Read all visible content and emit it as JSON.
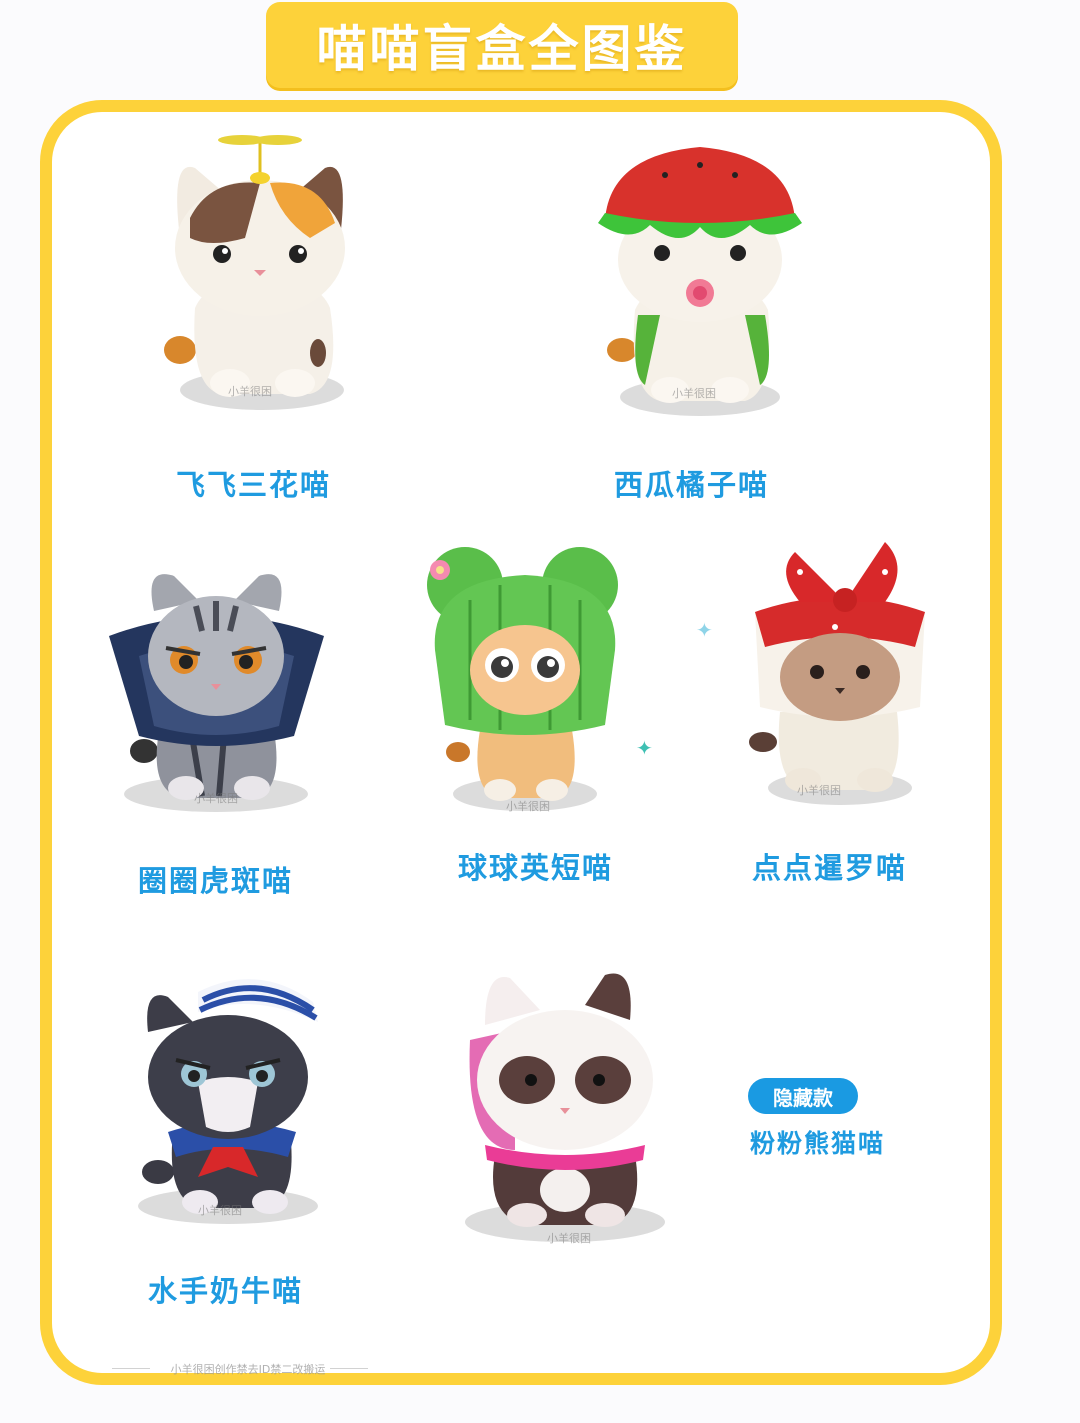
{
  "title": "喵喵盲盒全图鉴",
  "figures": [
    {
      "name": "飞飞三花喵",
      "icon": "calico-cat-propeller-icon"
    },
    {
      "name": "西瓜橘子喵",
      "icon": "watermelon-hat-cat-icon"
    },
    {
      "name": "圈圈虎斑喵",
      "icon": "tabby-cone-cat-icon"
    },
    {
      "name": "球球英短喵",
      "icon": "cactus-hat-cat-icon"
    },
    {
      "name": "点点暹罗喵",
      "icon": "siamese-bow-cat-icon"
    },
    {
      "name": "水手奶牛喵",
      "icon": "sailor-tuxedo-cat-icon"
    },
    {
      "name": "粉粉熊猫喵",
      "icon": "panda-hood-cat-icon"
    }
  ],
  "hidden_badge": "隐藏款",
  "watermark": "小羊很困",
  "footer_note": "小羊很困创作禁去ID禁二改搬运",
  "colors": {
    "frame": "#fdd23a",
    "label": "#1f9be0",
    "badge": "#1a9ae2"
  }
}
